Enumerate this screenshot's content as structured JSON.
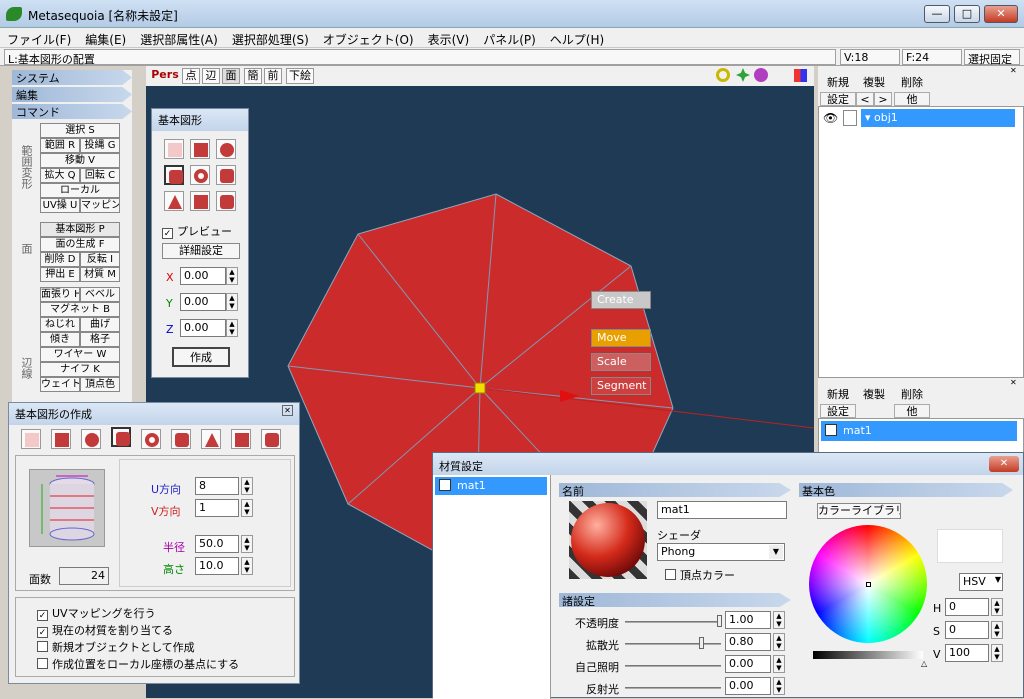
{
  "window": {
    "title": "Metasequoia [名称未設定]",
    "min": "—",
    "max": "□",
    "close": "✕"
  },
  "menu": [
    "ファイル(F)",
    "編集(E)",
    "選択部属性(A)",
    "選択部処理(S)",
    "オブジェクト(O)",
    "表示(V)",
    "パネル(P)",
    "ヘルプ(H)"
  ],
  "status": {
    "left": "L:基本図形の配置",
    "v": "V:18",
    "f": "F:24",
    "mode": "選択固定"
  },
  "left_panel": {
    "system": "システム",
    "edit": "編集",
    "command": "コマンド",
    "g1_label": "範囲",
    "g2_label": "変形",
    "g3_label": "面",
    "g4_label": "辺線",
    "buttons": [
      "選択 S",
      "範囲 R",
      "投縄 G",
      "移動 V",
      "拡大 Q",
      "回転 C",
      "ローカル",
      "UV操 U",
      "マッピング",
      "基本図形 P",
      "面の生成 F",
      "削除 D",
      "反転 I",
      "押出 E",
      "材質 M",
      "面張り H",
      "ベベル",
      "マグネット B",
      "ねじれ",
      "曲げ",
      "傾き",
      "格子",
      "ワイヤー W",
      "ナイフ K",
      "ウェイト",
      "頂点色"
    ]
  },
  "viewport": {
    "toolbar": [
      "Pers",
      "点",
      "辺",
      "面",
      "簡",
      "前",
      "下絵"
    ],
    "gizmo": {
      "create": "Create",
      "move": "Move",
      "scale": "Scale",
      "segment": "Segment"
    }
  },
  "basic_shape": {
    "title": "基本図形",
    "preview": "プレビュー",
    "detail": "詳細設定",
    "x": "X",
    "y": "Y",
    "z": "Z",
    "xv": "0.00",
    "yv": "0.00",
    "zv": "0.00",
    "create": "作成"
  },
  "shape_create": {
    "title": "基本図形の作成",
    "u_label": "U方向",
    "u_value": "8",
    "v_label": "V方向",
    "v_value": "1",
    "radius_label": "半径",
    "radius_value": "50.0",
    "height_label": "高さ",
    "height_value": "10.0",
    "faces_label": "面数",
    "faces_value": "24",
    "opts": [
      "UVマッピングを行う",
      "現在の材質を割り当てる",
      "新規オブジェクトとして作成",
      "作成位置をローカル座標の基点にする"
    ],
    "opts_checked": [
      true,
      true,
      false,
      false
    ]
  },
  "object_panel": {
    "row1": [
      "新規",
      "複製",
      "削除"
    ],
    "row2": [
      "設定",
      "<",
      ">",
      "他"
    ],
    "object_name": "obj1"
  },
  "material_panel": {
    "row1": [
      "新規",
      "複製",
      "削除"
    ],
    "row2": [
      "設定",
      "他"
    ],
    "material_name": "mat1"
  },
  "material_settings": {
    "title": "材質設定",
    "list_item": "mat1",
    "name_head": "名前",
    "name_value": "mat1",
    "shader_label": "シェーダ",
    "shader_value": "Phong",
    "vertex_color": "頂点カラー",
    "props_head": "諸設定",
    "props": [
      {
        "label": "不透明度",
        "value": "1.00"
      },
      {
        "label": "拡散光",
        "value": "0.80"
      },
      {
        "label": "自己照明",
        "value": "0.00"
      },
      {
        "label": "反射光",
        "value": "0.00"
      }
    ],
    "basecolor_head": "基本色",
    "library": "カラーライブラリ",
    "mode": "HSV",
    "h": "H",
    "hv": "0",
    "s": "S",
    "sv": "0",
    "v": "V",
    "vv": "100"
  }
}
